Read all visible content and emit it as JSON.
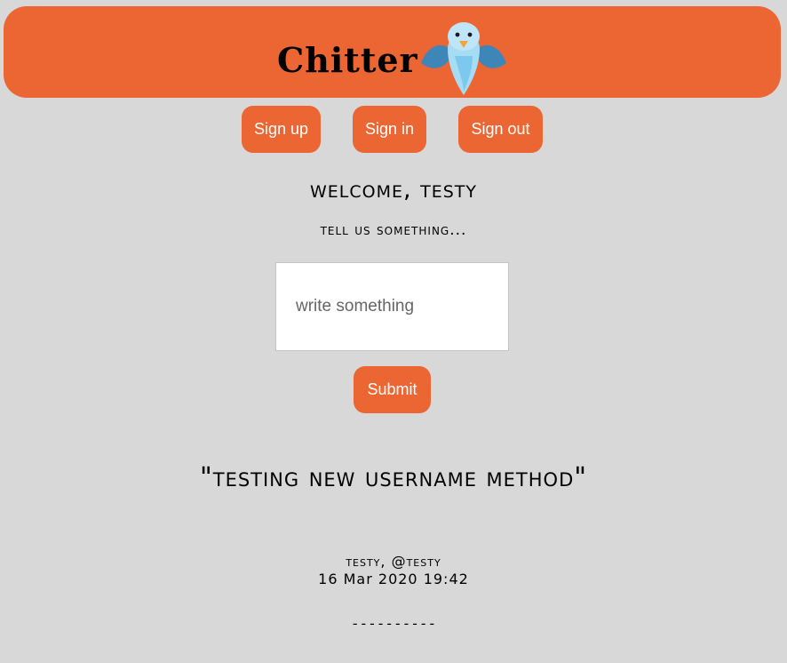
{
  "header": {
    "brand": "Chitter",
    "logo_icon": "bird-icon",
    "background_color": "#eb6633"
  },
  "nav": {
    "sign_up": "Sign up",
    "sign_in": "Sign in",
    "sign_out": "Sign out"
  },
  "main": {
    "welcome": "welcome, testy",
    "prompt": "tell us something...",
    "compose_placeholder": "write something",
    "submit_label": "Submit"
  },
  "peeps": [
    {
      "text": "\"testing new username method\"",
      "author": "testy, @testy",
      "timestamp": "16 Mar 2020 19:42",
      "separator": "----------"
    }
  ]
}
